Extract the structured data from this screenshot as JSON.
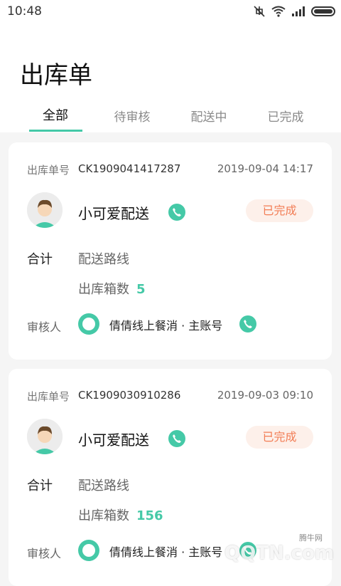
{
  "status": {
    "time": "10:48"
  },
  "page": {
    "title": "出库单"
  },
  "tabs": [
    {
      "label": "全部"
    },
    {
      "label": "待审核"
    },
    {
      "label": "配送中"
    },
    {
      "label": "已完成"
    }
  ],
  "orders": [
    {
      "label_no": "出库单号",
      "order_no": "CK1909041417287",
      "datetime": "2019-09-04 14:17",
      "name": "小可爱配送",
      "status": "已完成",
      "label_total": "合计",
      "route": "配送路线",
      "boxes_label": "出库箱数",
      "boxes": "5",
      "label_reviewer": "审核人",
      "reviewer": "倩倩线上餐消 · 主账号"
    },
    {
      "label_no": "出库单号",
      "order_no": "CK1909030910286",
      "datetime": "2019-09-03 09:10",
      "name": "小可爱配送",
      "status": "已完成",
      "label_total": "合计",
      "route": "配送路线",
      "boxes_label": "出库箱数",
      "boxes": "156",
      "label_reviewer": "审核人",
      "reviewer": "倩倩线上餐消 · 主账号"
    }
  ],
  "watermark": {
    "main": "QQTN.com",
    "small": "腾牛网"
  },
  "colors": {
    "accent": "#45c9a7",
    "status_text": "#f27d55",
    "status_bg": "#fdf0ea"
  }
}
